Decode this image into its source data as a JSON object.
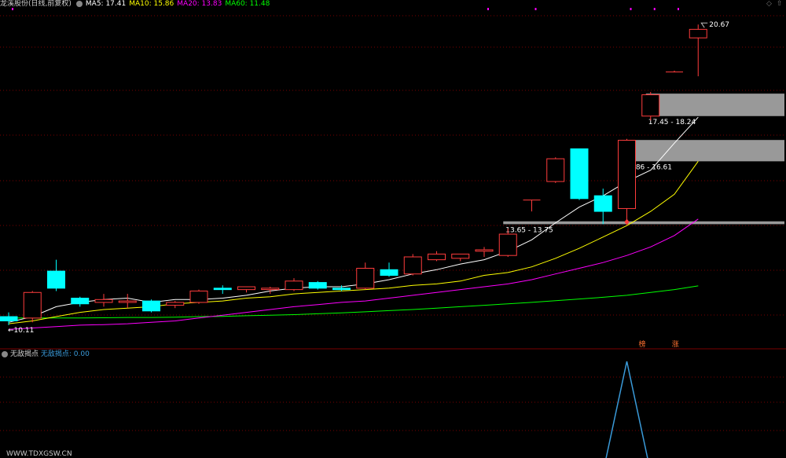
{
  "header": {
    "stock_name": "龙溪股份",
    "adjust_mode": "(日线,前复权)",
    "ma5": "MA5: 17.41",
    "ma10": "MA10: 15.86",
    "ma20": "MA20: 13.83",
    "ma60": "MA60: 11.48"
  },
  "indicator": {
    "title": "无敌揭点",
    "value_label": "无敌揭点: 0.00"
  },
  "watermark": "WWW.TDXGSW.CN",
  "colors": {
    "up": "#ff3c3c",
    "down": "#00ffff",
    "ma5": "#ffffff",
    "ma10": "#ffff00",
    "ma20": "#ff00ff",
    "ma60": "#00ff00",
    "zone": "#999999",
    "indicator": "#3a9ad9",
    "grid": "#7a0000"
  },
  "chart_data": {
    "type": "candlestick",
    "ylim": [
      9.6,
      21.2
    ],
    "price_labels": {
      "high": "20.67",
      "low": "10.11"
    },
    "candles": [
      {
        "o": 10.4,
        "h": 10.55,
        "l": 10.1,
        "c": 10.25
      },
      {
        "o": 10.35,
        "h": 11.3,
        "l": 10.2,
        "c": 11.25
      },
      {
        "o": 12.0,
        "h": 12.4,
        "l": 11.3,
        "c": 11.4
      },
      {
        "o": 11.05,
        "h": 11.1,
        "l": 10.75,
        "c": 10.85
      },
      {
        "o": 10.9,
        "h": 11.2,
        "l": 10.75,
        "c": 11.0
      },
      {
        "o": 10.9,
        "h": 11.2,
        "l": 10.7,
        "c": 10.95
      },
      {
        "o": 10.95,
        "h": 11.0,
        "l": 10.55,
        "c": 10.6
      },
      {
        "o": 10.8,
        "h": 10.95,
        "l": 10.7,
        "c": 10.9
      },
      {
        "o": 10.9,
        "h": 11.35,
        "l": 10.85,
        "c": 11.3
      },
      {
        "o": 11.4,
        "h": 11.5,
        "l": 11.2,
        "c": 11.35
      },
      {
        "o": 11.35,
        "h": 11.45,
        "l": 11.25,
        "c": 11.45
      },
      {
        "o": 11.35,
        "h": 11.45,
        "l": 11.2,
        "c": 11.4
      },
      {
        "o": 11.35,
        "h": 11.75,
        "l": 11.3,
        "c": 11.65
      },
      {
        "o": 11.6,
        "h": 11.65,
        "l": 11.35,
        "c": 11.4
      },
      {
        "o": 11.4,
        "h": 11.5,
        "l": 11.3,
        "c": 11.35
      },
      {
        "o": 11.4,
        "h": 12.3,
        "l": 11.35,
        "c": 12.1
      },
      {
        "o": 12.05,
        "h": 12.3,
        "l": 11.8,
        "c": 11.85
      },
      {
        "o": 11.9,
        "h": 12.6,
        "l": 11.85,
        "c": 12.5
      },
      {
        "o": 12.4,
        "h": 12.7,
        "l": 12.35,
        "c": 12.6
      },
      {
        "o": 12.45,
        "h": 12.6,
        "l": 12.35,
        "c": 12.6
      },
      {
        "o": 12.7,
        "h": 12.85,
        "l": 12.5,
        "c": 12.75
      },
      {
        "o": 12.55,
        "h": 13.5,
        "l": 12.5,
        "c": 13.3
      },
      {
        "o": 14.5,
        "h": 14.5,
        "l": 14.1,
        "c": 14.5
      },
      {
        "o": 15.15,
        "h": 16.0,
        "l": 15.1,
        "c": 15.95
      },
      {
        "o": 16.3,
        "h": 16.3,
        "l": 14.5,
        "c": 14.55
      },
      {
        "o": 14.65,
        "h": 14.9,
        "l": 13.65,
        "c": 14.1
      },
      {
        "o": 14.2,
        "h": 16.65,
        "l": 13.65,
        "c": 16.6
      },
      {
        "o": 17.45,
        "h": 18.3,
        "l": 17.3,
        "c": 18.2
      },
      {
        "o": 19.0,
        "h": 19.05,
        "l": 19.0,
        "c": 19.0
      },
      {
        "o": 20.2,
        "h": 20.67,
        "l": 18.85,
        "c": 20.5
      }
    ],
    "ma5": [
      10.2,
      10.4,
      10.75,
      10.9,
      11.0,
      11.05,
      10.9,
      11.0,
      11.0,
      11.05,
      11.15,
      11.3,
      11.4,
      11.45,
      11.45,
      11.55,
      11.7,
      11.9,
      12.05,
      12.25,
      12.4,
      12.7,
      13.1,
      13.7,
      14.25,
      14.65,
      15.15,
      15.55,
      16.5,
      17.41
    ],
    "ma10": [
      10.15,
      10.25,
      10.4,
      10.55,
      10.65,
      10.7,
      10.75,
      10.85,
      10.9,
      10.95,
      11.05,
      11.1,
      11.2,
      11.25,
      11.3,
      11.35,
      11.4,
      11.5,
      11.55,
      11.65,
      11.85,
      11.95,
      12.15,
      12.45,
      12.8,
      13.2,
      13.6,
      14.1,
      14.7,
      15.86
    ],
    "ma20": [
      9.95,
      10.0,
      10.05,
      10.1,
      10.12,
      10.15,
      10.2,
      10.25,
      10.35,
      10.45,
      10.55,
      10.65,
      10.75,
      10.82,
      10.9,
      10.95,
      11.05,
      11.15,
      11.25,
      11.35,
      11.45,
      11.55,
      11.7,
      11.9,
      12.1,
      12.3,
      12.55,
      12.85,
      13.25,
      13.83
    ],
    "ma60": [
      10.35,
      10.35,
      10.35,
      10.35,
      10.36,
      10.37,
      10.37,
      10.38,
      10.4,
      10.41,
      10.43,
      10.45,
      10.47,
      10.5,
      10.53,
      10.57,
      10.61,
      10.65,
      10.7,
      10.75,
      10.8,
      10.85,
      10.9,
      10.96,
      11.02,
      11.08,
      11.15,
      11.25,
      11.35,
      11.48
    ],
    "zones": [
      {
        "low": 13.65,
        "high": 13.75,
        "label": "13.65 - 13.75",
        "start_index": 21
      },
      {
        "low": 15.86,
        "high": 16.61,
        "label": "15.86 - 16.61",
        "start_index": 26
      },
      {
        "low": 17.45,
        "high": 18.24,
        "label": "17.45 - 18.24",
        "start_index": 27
      }
    ],
    "signals": [
      {
        "index": 26,
        "label": "榜"
      },
      {
        "index": 27,
        "label": "涨"
      }
    ],
    "indicator_series": {
      "peak_index": 26,
      "peak_value": 1,
      "value": 0.0
    }
  }
}
